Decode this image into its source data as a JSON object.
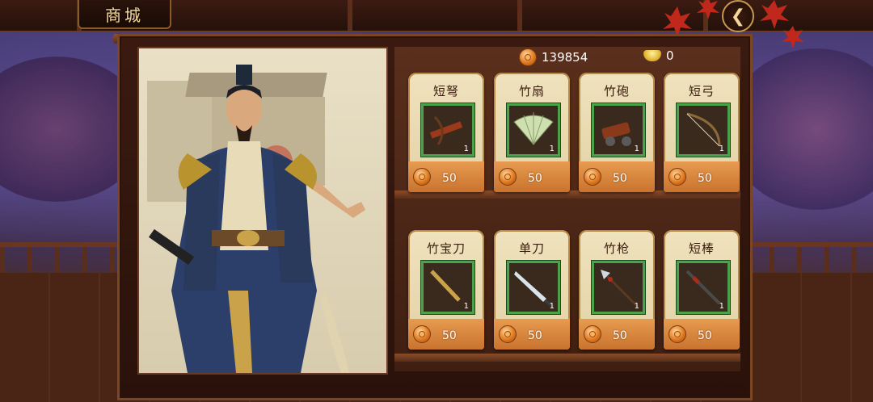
{
  "header": {
    "title": "商城"
  },
  "currency": {
    "coins": "139854",
    "ingots": "0"
  },
  "items": [
    {
      "name": "短弩",
      "qty": "1",
      "price": "50",
      "icon": "crossbow-icon"
    },
    {
      "name": "竹扇",
      "qty": "1",
      "price": "50",
      "icon": "fan-icon"
    },
    {
      "name": "竹砲",
      "qty": "1",
      "price": "50",
      "icon": "cannon-icon"
    },
    {
      "name": "短弓",
      "qty": "1",
      "price": "50",
      "icon": "bow-icon"
    },
    {
      "name": "竹宝刀",
      "qty": "1",
      "price": "50",
      "icon": "saber-icon"
    },
    {
      "name": "单刀",
      "qty": "1",
      "price": "50",
      "icon": "blade-icon"
    },
    {
      "name": "竹枪",
      "qty": "1",
      "price": "50",
      "icon": "spear-icon"
    },
    {
      "name": "短棒",
      "qty": "1",
      "price": "50",
      "icon": "staff-icon"
    }
  ]
}
